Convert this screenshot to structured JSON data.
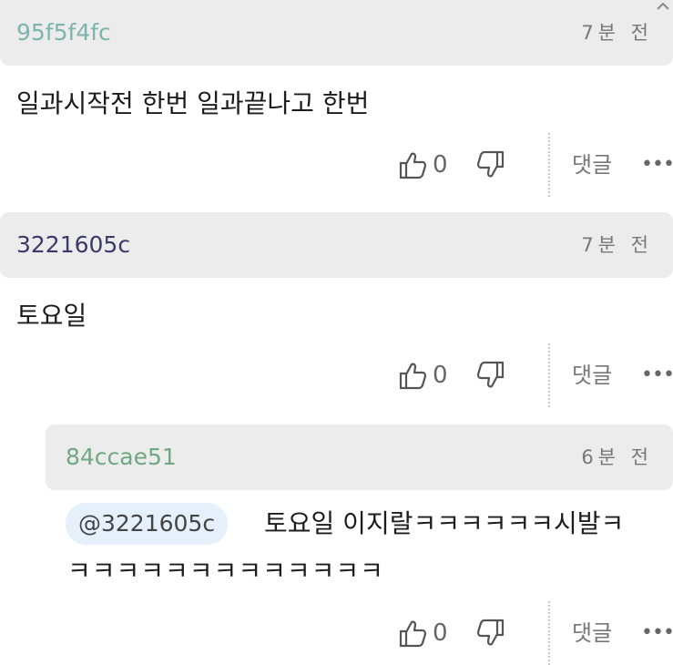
{
  "comments": [
    {
      "username": "95f5f4fc",
      "username_color": "#7db4ad",
      "time": "7분 전",
      "text": "일과시작전 한번 일과끝나고 한번",
      "likes": "0",
      "reply_label": "댓글",
      "more_label": "•••"
    },
    {
      "username": "3221605c",
      "username_color": "#3c3a67",
      "time": "7분 전",
      "text": "토요일",
      "likes": "0",
      "reply_label": "댓글",
      "more_label": "•••"
    },
    {
      "username": "84ccae51",
      "username_color": "#6fa882",
      "time": "6분 전",
      "mention": "@3221605c",
      "text_line1": "토요일 이지랄ㅋㅋㅋㅋㅋㅋ시발ㅋ",
      "text_line2": "ㅋㅋㅋㅋㅋㅋㅋㅋㅋㅋㅋㅋㅋ",
      "likes": "0",
      "reply_label": "댓글",
      "more_label": "•••"
    }
  ],
  "corner_icon": "chevron-up-icon"
}
